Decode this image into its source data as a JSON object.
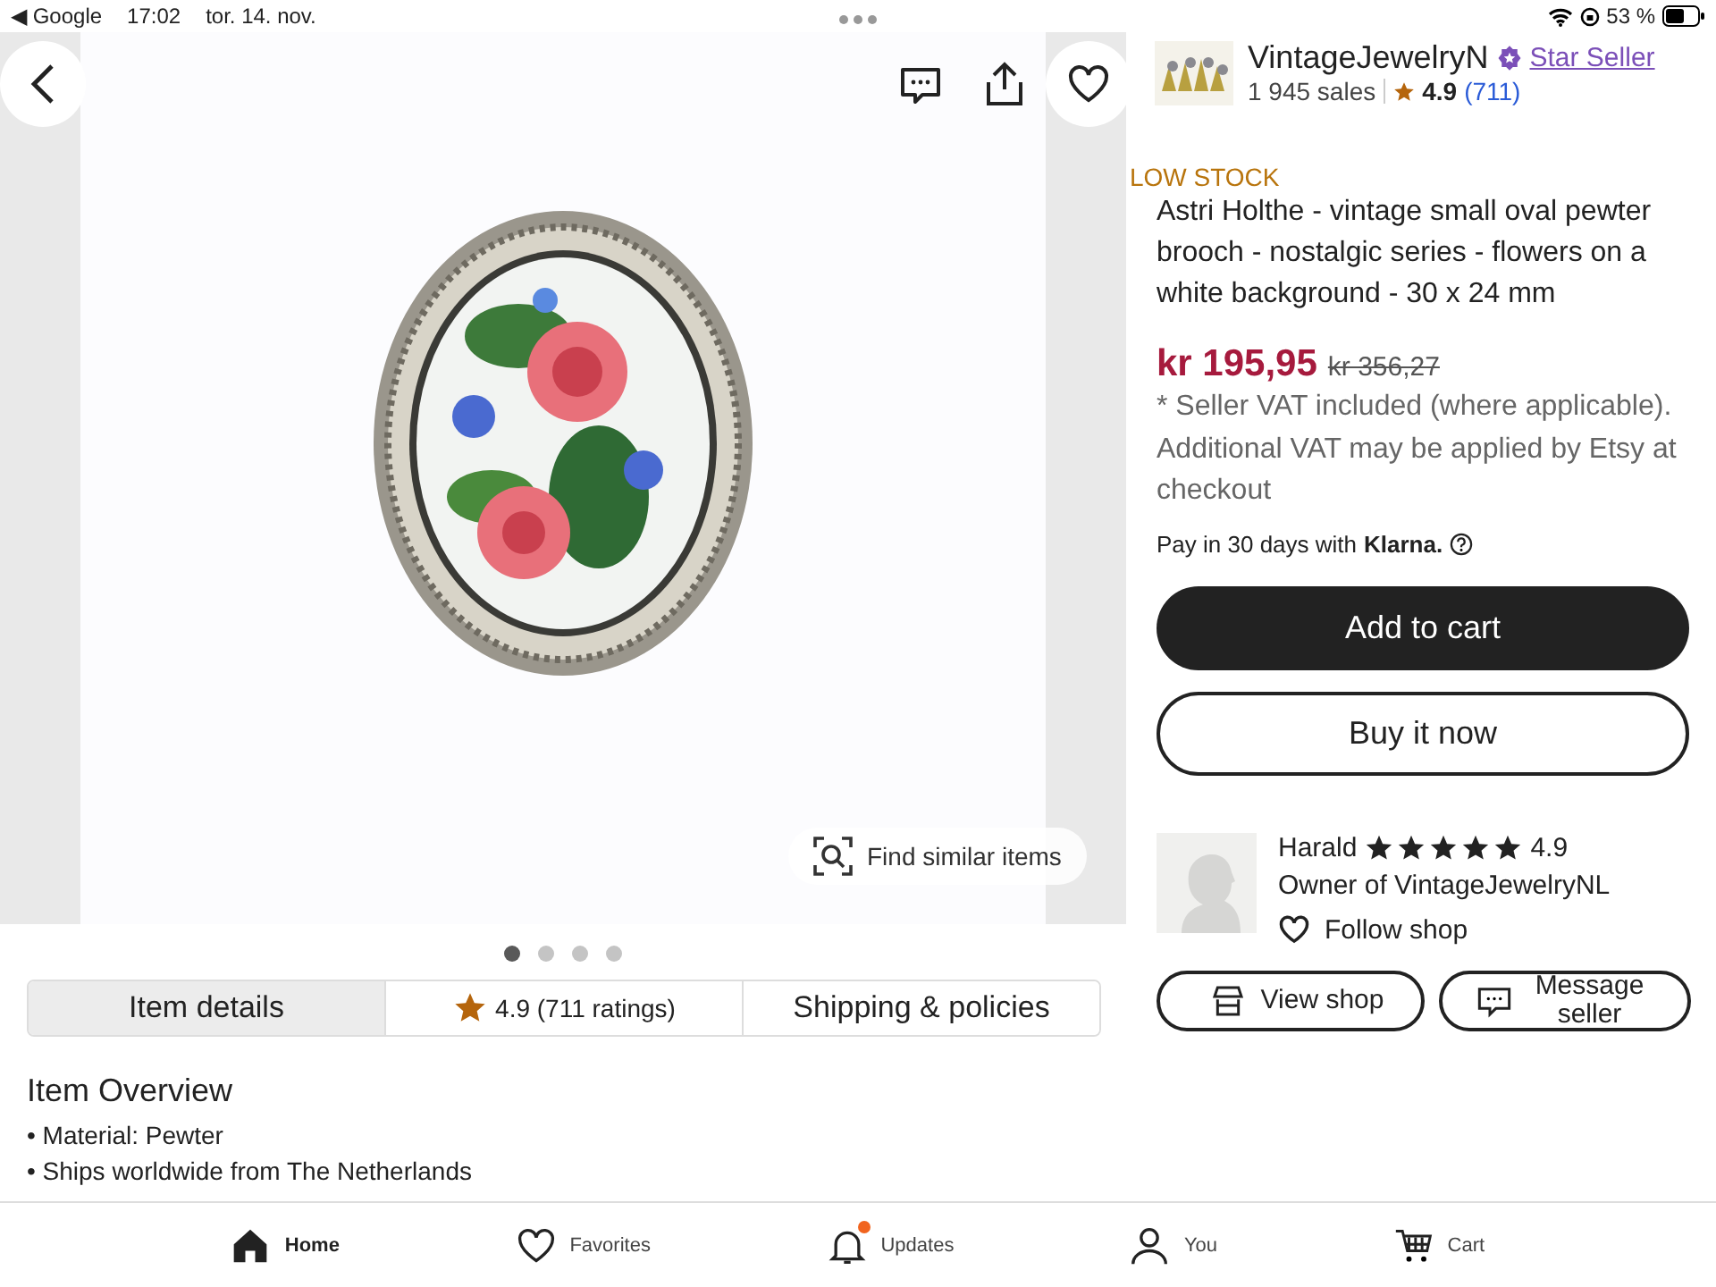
{
  "status_bar": {
    "back_app": "◀ Google",
    "time": "17:02",
    "date": "tor. 14. nov.",
    "battery": "53 %"
  },
  "gallery": {
    "find_similar": "Find similar items",
    "dots": [
      {
        "selected": true
      },
      {
        "selected": false
      },
      {
        "selected": false
      },
      {
        "selected": false
      }
    ]
  },
  "tabs": [
    {
      "label": "Item details",
      "selected": true,
      "kind": "text"
    },
    {
      "label": "4.9",
      "extra": "(711 ratings)",
      "selected": false,
      "kind": "rating"
    },
    {
      "label": "Shipping & policies",
      "selected": false,
      "kind": "text"
    }
  ],
  "overview": {
    "heading": "Item Overview",
    "bullets": [
      "• Material: Pewter",
      "• Ships worldwide from The Netherlands"
    ]
  },
  "shop": {
    "name": "VintageJewelryN",
    "badge": "Star Seller",
    "sales": "1 945 sales",
    "rating": "4.9",
    "reviews": "(711)"
  },
  "listing": {
    "stock": "LOW STOCK",
    "title": "Astri Holthe - vintage small oval pewter brooch - nostalgic series - flowers on a white background - 30 x 24 mm",
    "price": "kr 195,95",
    "old_price": "kr 356,27",
    "vat_note": "* Seller VAT included (where applicable). Additional VAT may be applied by Etsy at checkout",
    "pay_later": "Pay in 30 days with",
    "pay_brand": "Klarna."
  },
  "actions": [
    "Add to cart",
    "Buy it now"
  ],
  "seller": {
    "name": "Harald",
    "stars": 5,
    "rating": "4.9",
    "role": "Owner of VintageJewelryNL",
    "follow": "Follow shop",
    "buttons": [
      {
        "label": "View shop",
        "kind": "shop"
      },
      {
        "label": "Message seller",
        "kind": "message"
      }
    ]
  },
  "nav": [
    {
      "label": "Home",
      "selected": true,
      "kind": "home",
      "badge": false
    },
    {
      "label": "Favorites",
      "selected": false,
      "kind": "heart",
      "badge": false
    },
    {
      "label": "Updates",
      "selected": false,
      "kind": "bell",
      "badge": true
    },
    {
      "label": "You",
      "selected": false,
      "kind": "person",
      "badge": false
    },
    {
      "label": "Cart",
      "selected": false,
      "kind": "cart",
      "badge": false
    }
  ]
}
